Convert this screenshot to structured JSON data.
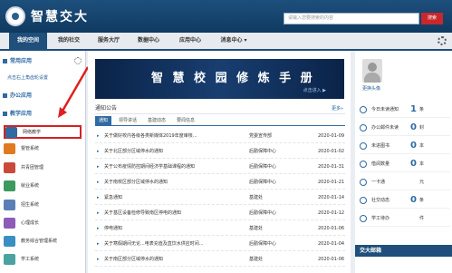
{
  "header": {
    "logo_text": "智慧交大",
    "search_placeholder": "请输入您要搜索的内容",
    "search_button": "搜索"
  },
  "nav": {
    "items": [
      "我的空间",
      "我的社交",
      "服务大厅",
      "数据中心",
      "应用中心",
      "消息中心 ▾"
    ],
    "active": "我的空间"
  },
  "left": {
    "section_common": "常用应用",
    "common_link": "点击右上角齿轮设置",
    "section_office": "办公应用",
    "section_teach": "教学应用",
    "apps": [
      "网络教学",
      "督管系统",
      "共青团管理",
      "就业系统",
      "招生系统",
      "心理成长",
      "教务综合管理系统",
      "学工系统"
    ]
  },
  "banner": {
    "title": "智 慧 校 园 修 炼 手 册",
    "subtitle": "点击进入 ▶"
  },
  "announcements": {
    "title": "通知公告",
    "more": "更多»",
    "tabs": [
      "通知",
      "领导讲话",
      "基建动态",
      "要闻信息"
    ],
    "rows": [
      {
        "title": "关于做好校内各级各类新媒体2019年度审核...",
        "dept": "党委宣传部",
        "date": "2020-01-09"
      },
      {
        "title": "关于北区部分区域停水的通知",
        "dept": "后勤保障中心",
        "date": "2020-01-02"
      },
      {
        "title": "关于公布疫情防控期间经济学基础课程的通知",
        "dept": "后勤保障中心",
        "date": "2020-01-31"
      },
      {
        "title": "关于南校区部分区域停水的通知",
        "dept": "后勤保障中心",
        "date": "2020-01-21"
      },
      {
        "title": "紧急通知",
        "dept": "基建处",
        "date": "2020-01-14"
      },
      {
        "title": "关于基区设备检修导致南区停电的通知",
        "dept": "后勤保障中心",
        "date": "2020-01-12"
      },
      {
        "title": "停电通知",
        "dept": "基建处",
        "date": "2020-01-06"
      },
      {
        "title": "关于寒假期间无论...电表充值及直饮水供应时间...",
        "dept": "后勤保障中心",
        "date": "2020-01-04"
      },
      {
        "title": "关于南区部分区域停水的通知",
        "dept": "基建处",
        "date": "2020-01-06"
      }
    ]
  },
  "profile": {
    "change_avatar": "更换头像"
  },
  "stats": [
    {
      "label": "今日未读通知",
      "value": "1",
      "unit": "条"
    },
    {
      "label": "办公邮件未读",
      "value": "0",
      "unit": "封"
    },
    {
      "label": "未进图书",
      "value": "0",
      "unit": "本"
    },
    {
      "label": "借阅数量",
      "value": "0",
      "unit": "本"
    },
    {
      "label": "一卡通",
      "value": "",
      "unit": "元"
    },
    {
      "label": "社交动态",
      "value": "0",
      "unit": "条"
    },
    {
      "label": "学工待办",
      "value": "",
      "unit": "件"
    }
  ],
  "mail": {
    "title": "交大邮箱"
  },
  "colors": {
    "primary": "#1f4f7a",
    "accent": "#d32222",
    "link": "#2f6aa3"
  }
}
